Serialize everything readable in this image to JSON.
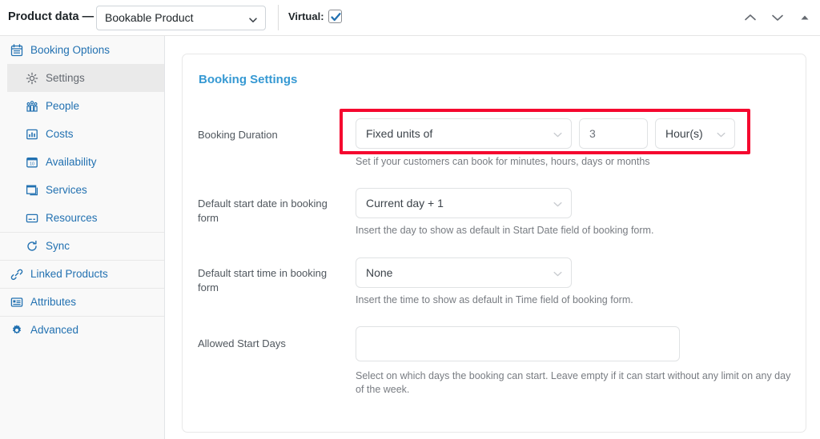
{
  "header": {
    "title": "Product data —",
    "product_type": "Bookable Product",
    "virtual_label": "Virtual:",
    "virtual_checked": true,
    "actions": [
      {
        "name": "move-up-icon",
        "label": "Move up"
      },
      {
        "name": "move-down-icon",
        "label": "Move down"
      },
      {
        "name": "collapse-icon",
        "label": "Toggle panel"
      }
    ]
  },
  "sidebar": {
    "items": [
      {
        "label": "Booking Options",
        "icon": "calendar-icon",
        "active": false,
        "sub": false,
        "group_top": false
      },
      {
        "label": "Settings",
        "icon": "gear-icon",
        "active": true,
        "sub": true,
        "group_top": false
      },
      {
        "label": "People",
        "icon": "people-icon",
        "active": false,
        "sub": true,
        "group_top": false
      },
      {
        "label": "Costs",
        "icon": "chart-bar-icon",
        "active": false,
        "sub": true,
        "group_top": false
      },
      {
        "label": "Availability",
        "icon": "calendar-day-icon",
        "active": false,
        "sub": true,
        "group_top": false
      },
      {
        "label": "Services",
        "icon": "window-icon",
        "active": false,
        "sub": true,
        "group_top": false
      },
      {
        "label": "Resources",
        "icon": "card-icon",
        "active": false,
        "sub": true,
        "group_top": false
      },
      {
        "label": "Sync",
        "icon": "sync-icon",
        "active": false,
        "sub": true,
        "group_top": true
      },
      {
        "label": "Linked Products",
        "icon": "link-icon",
        "active": false,
        "sub": false,
        "group_top": true
      },
      {
        "label": "Attributes",
        "icon": "list-box-icon",
        "active": false,
        "sub": false,
        "group_top": true
      },
      {
        "label": "Advanced",
        "icon": "cog-icon",
        "active": false,
        "sub": false,
        "group_top": true
      }
    ]
  },
  "main": {
    "section_title": "Booking Settings",
    "fields": {
      "booking_duration": {
        "label": "Booking Duration",
        "duration_type": "Fixed units of",
        "duration_value": "3",
        "duration_unit": "Hour(s)",
        "help": "Set if your customers can book for minutes, hours, days or months"
      },
      "default_start_date": {
        "label": "Default start date in booking form",
        "value": "Current day + 1",
        "help": "Insert the day to show as default in Start Date field of booking form."
      },
      "default_start_time": {
        "label": "Default start time in booking form",
        "value": "None",
        "help": "Insert the time to show as default in Time field of booking form."
      },
      "allowed_start_days": {
        "label": "Allowed Start Days",
        "value": "",
        "help": "Select on which days the booking can start. Leave empty if it can start without any limit on any day of the week."
      }
    }
  },
  "colors": {
    "link_blue": "#2271b1",
    "section_blue": "#3699d3",
    "highlight_red": "#f5072f",
    "sidebar_bg": "#f9f9f9",
    "active_bg": "#eaeaea"
  }
}
